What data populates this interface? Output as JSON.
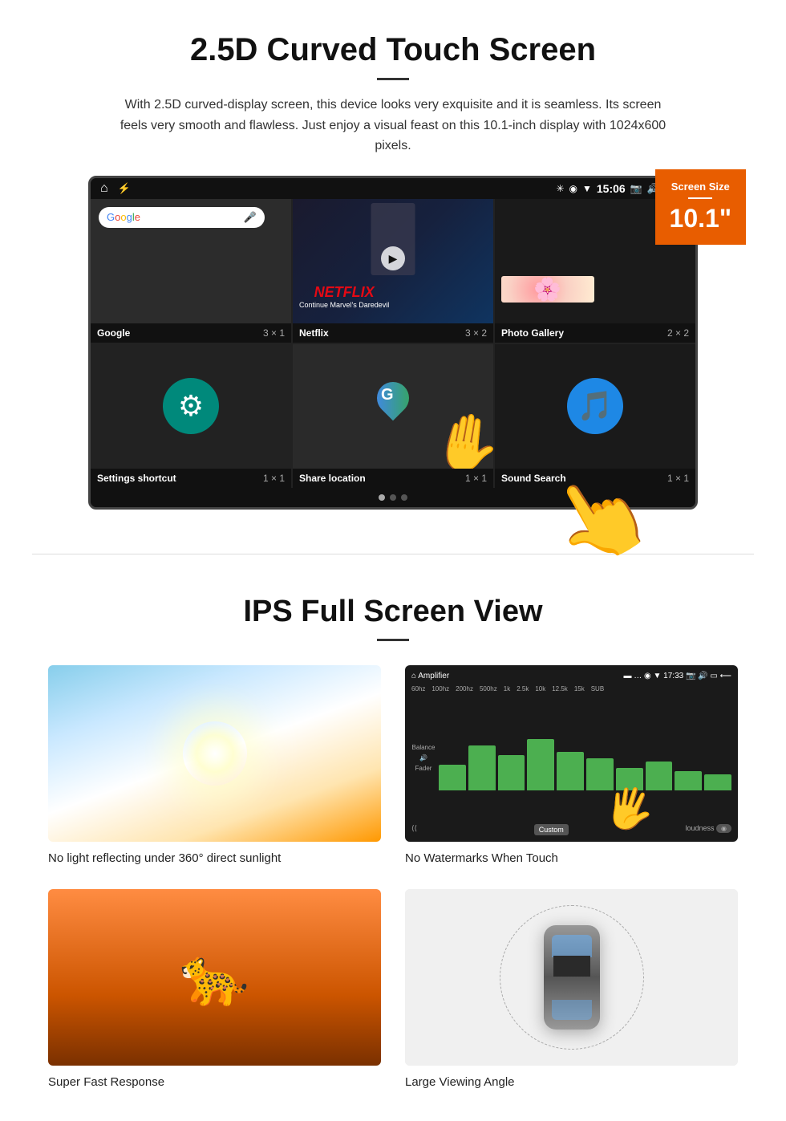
{
  "section1": {
    "title": "2.5D Curved Touch Screen",
    "description": "With 2.5D curved-display screen, this device looks very exquisite and it is seamless. Its screen feels very smooth and flawless. Just enjoy a visual feast on this 10.1-inch display with 1024x600 pixels.",
    "screen_badge": {
      "label": "Screen Size",
      "size": "10.1\""
    },
    "status_bar": {
      "time": "15:06"
    },
    "apps": [
      {
        "name": "Google",
        "size": "3 × 1"
      },
      {
        "name": "Netflix",
        "size": "3 × 2"
      },
      {
        "name": "Photo Gallery",
        "size": "2 × 2"
      },
      {
        "name": "Settings shortcut",
        "size": "1 × 1"
      },
      {
        "name": "Share location",
        "size": "1 × 1"
      },
      {
        "name": "Sound Search",
        "size": "1 × 1"
      }
    ],
    "netflix": {
      "logo": "NETFLIX",
      "subtitle": "Continue Marvel's Daredevil"
    }
  },
  "section2": {
    "title": "IPS Full Screen View",
    "features": [
      {
        "id": "sunlight",
        "caption": "No light reflecting under 360° direct sunlight"
      },
      {
        "id": "amplifier",
        "caption": "No Watermarks When Touch"
      },
      {
        "id": "cheetah",
        "caption": "Super Fast Response"
      },
      {
        "id": "car",
        "caption": "Large Viewing Angle"
      }
    ]
  }
}
